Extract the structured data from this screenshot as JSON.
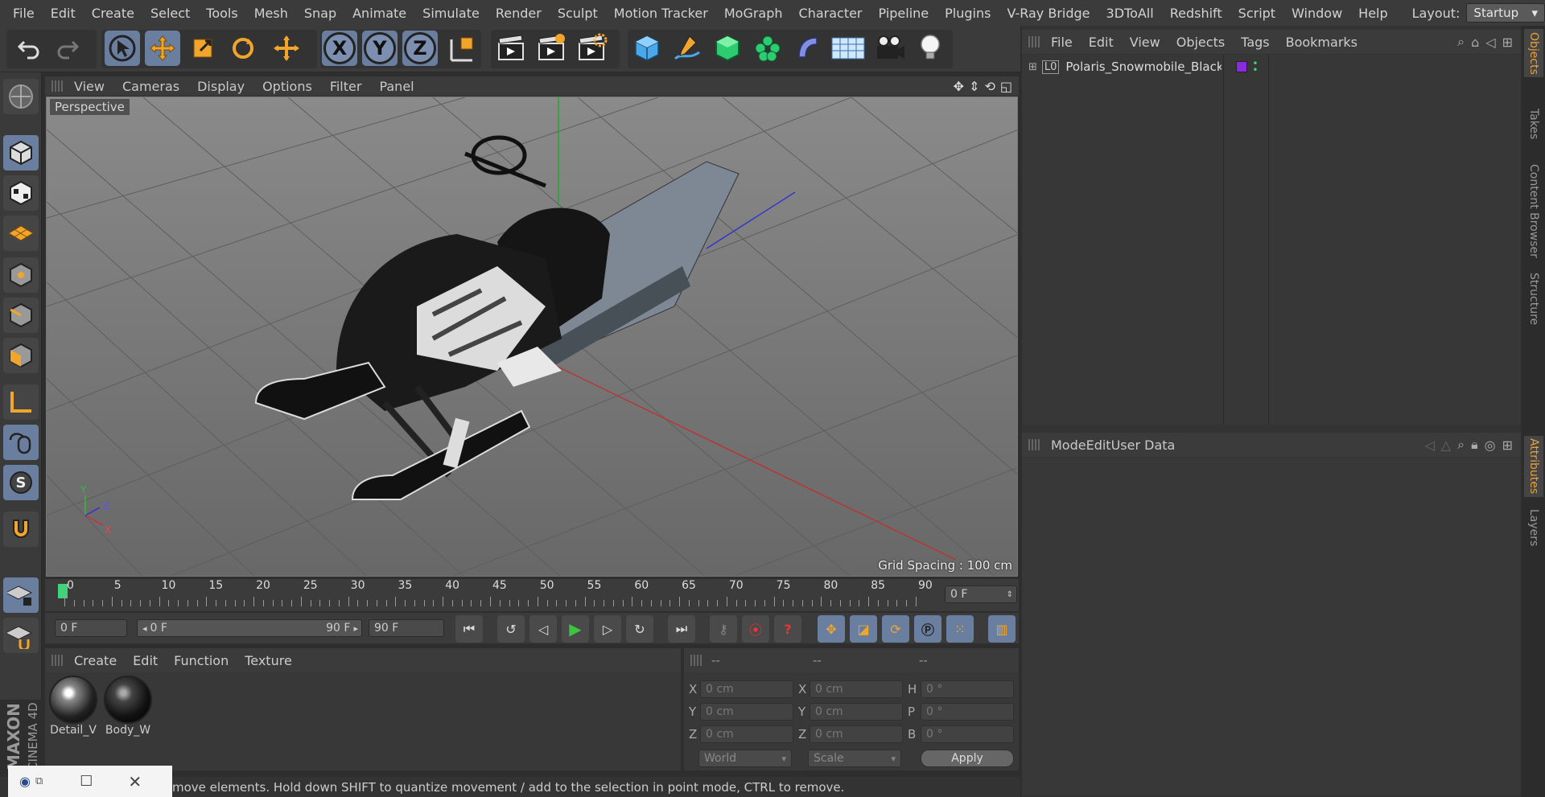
{
  "menubar": {
    "items": [
      "File",
      "Edit",
      "Create",
      "Select",
      "Tools",
      "Mesh",
      "Snap",
      "Animate",
      "Simulate",
      "Render",
      "Sculpt",
      "Motion Tracker",
      "MoGraph",
      "Character",
      "Pipeline",
      "Plugins",
      "V-Ray Bridge",
      "3DToAll",
      "Redshift",
      "Script",
      "Window",
      "Help"
    ],
    "layout_label": "Layout:",
    "layout_value": "Startup"
  },
  "toolbar": {
    "axis_x": "X",
    "axis_y": "Y",
    "axis_z": "Z"
  },
  "viewport": {
    "menu": [
      "View",
      "Cameras",
      "Display",
      "Options",
      "Filter",
      "Panel"
    ],
    "label": "Perspective",
    "grid_spacing": "Grid Spacing : 100 cm",
    "axis_y": "Y",
    "axis_z": "Z",
    "axis_x": "X"
  },
  "timeline": {
    "ticks": [
      "0",
      "5",
      "10",
      "15",
      "20",
      "25",
      "30",
      "35",
      "40",
      "45",
      "50",
      "55",
      "60",
      "65",
      "70",
      "75",
      "80",
      "85",
      "90"
    ],
    "current_frame": "0 F"
  },
  "playback": {
    "start_field": "0 F",
    "range_start": "0 F",
    "range_end": "90 F",
    "end_field": "90 F"
  },
  "materials": {
    "menu": [
      "Create",
      "Edit",
      "Function",
      "Texture"
    ],
    "items": [
      {
        "label": "Detail_V"
      },
      {
        "label": "Body_W"
      }
    ]
  },
  "coordinates": {
    "headers": [
      "--",
      "--",
      "--"
    ],
    "rows": [
      {
        "l1": "X",
        "v1": "0 cm",
        "l2": "X",
        "v2": "0 cm",
        "l3": "H",
        "v3": "0 °"
      },
      {
        "l1": "Y",
        "v1": "0 cm",
        "l2": "Y",
        "v2": "0 cm",
        "l3": "P",
        "v3": "0 °"
      },
      {
        "l1": "Z",
        "v1": "0 cm",
        "l2": "Z",
        "v2": "0 cm",
        "l3": "B",
        "v3": "0 °"
      }
    ],
    "space_select": "World",
    "mode_select": "Scale",
    "apply_label": "Apply"
  },
  "objects": {
    "menu": [
      "File",
      "Edit",
      "View",
      "Objects",
      "Tags",
      "Bookmarks"
    ],
    "items": [
      {
        "name": "Polaris_Snowmobile_Black",
        "tag_color": "#8a2be2"
      }
    ]
  },
  "attributes": {
    "menu": [
      "Mode",
      "Edit",
      "User Data"
    ]
  },
  "sidetabs": [
    "Objects",
    "Takes",
    "Content Browser",
    "Structure",
    "Attributes",
    "Layers"
  ],
  "status": {
    "text": "move elements. Hold down SHIFT to quantize movement / add to the selection in point mode, CTRL to remove."
  },
  "brand": {
    "maxon": "MAXON",
    "cinema": "CINEMA 4D"
  },
  "colors": {
    "accent": "#e6a03a",
    "selected_tool": "#6a7fa0",
    "play_green": "#3ec43e",
    "timeline_marker": "#41d37a"
  }
}
